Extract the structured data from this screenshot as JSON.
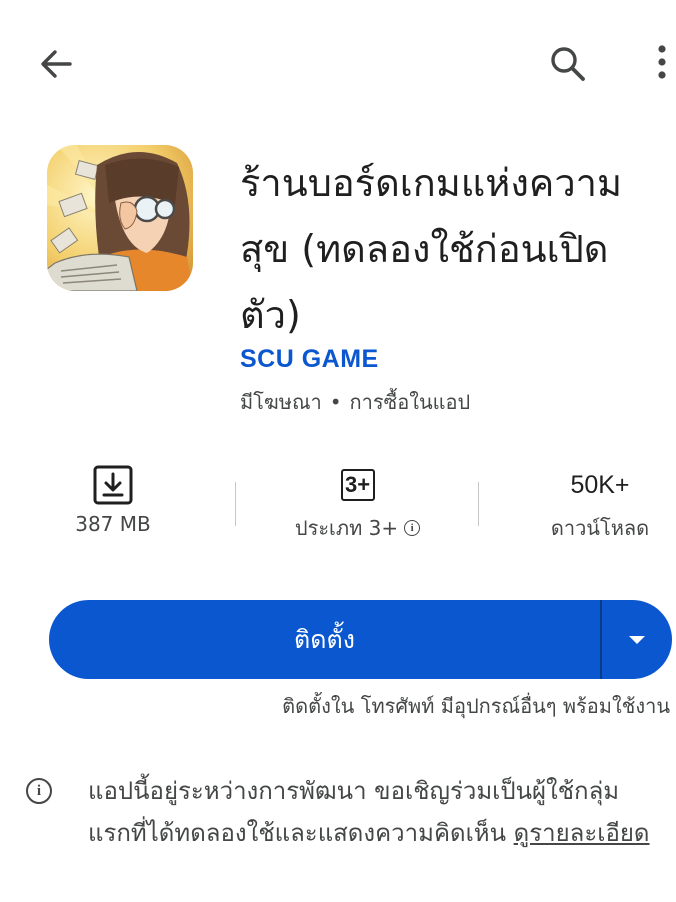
{
  "topbar": {
    "back_icon": "arrow-back-icon",
    "search_icon": "search-icon",
    "more_icon": "more-vert-icon"
  },
  "app": {
    "title": "ร้านบอร์ดเกมแห่งความสุข (ทดลองใช้ก่อนเปิดตัว)",
    "developer": "SCU GAME",
    "meta_ads": "มีโฆษณา",
    "meta_separator": "•",
    "meta_iap": "การซื้อในแอป"
  },
  "stats": {
    "size_label": "387 MB",
    "rating_badge": "3+",
    "rating_label": "ประเภท 3+",
    "downloads_value": "50K+",
    "downloads_label": "ดาวน์โหลด"
  },
  "install": {
    "button_label": "ติดตั้ง",
    "note": "ติดตั้งใน โทรศัพท์ มีอุปกรณ์อื่นๆ พร้อมใช้งาน"
  },
  "notice": {
    "text": "แอปนี้อยู่ระหว่างการพัฒนา ขอเชิญร่วมเป็นผู้ใช้กลุ่มแรกที่ได้ทดลองใช้และแสดงความคิดเห็น ",
    "link_label": "ดูรายละเอียด"
  },
  "colors": {
    "accent": "#0b57d0",
    "text_primary": "#1f1f1f",
    "text_secondary": "#444746"
  }
}
